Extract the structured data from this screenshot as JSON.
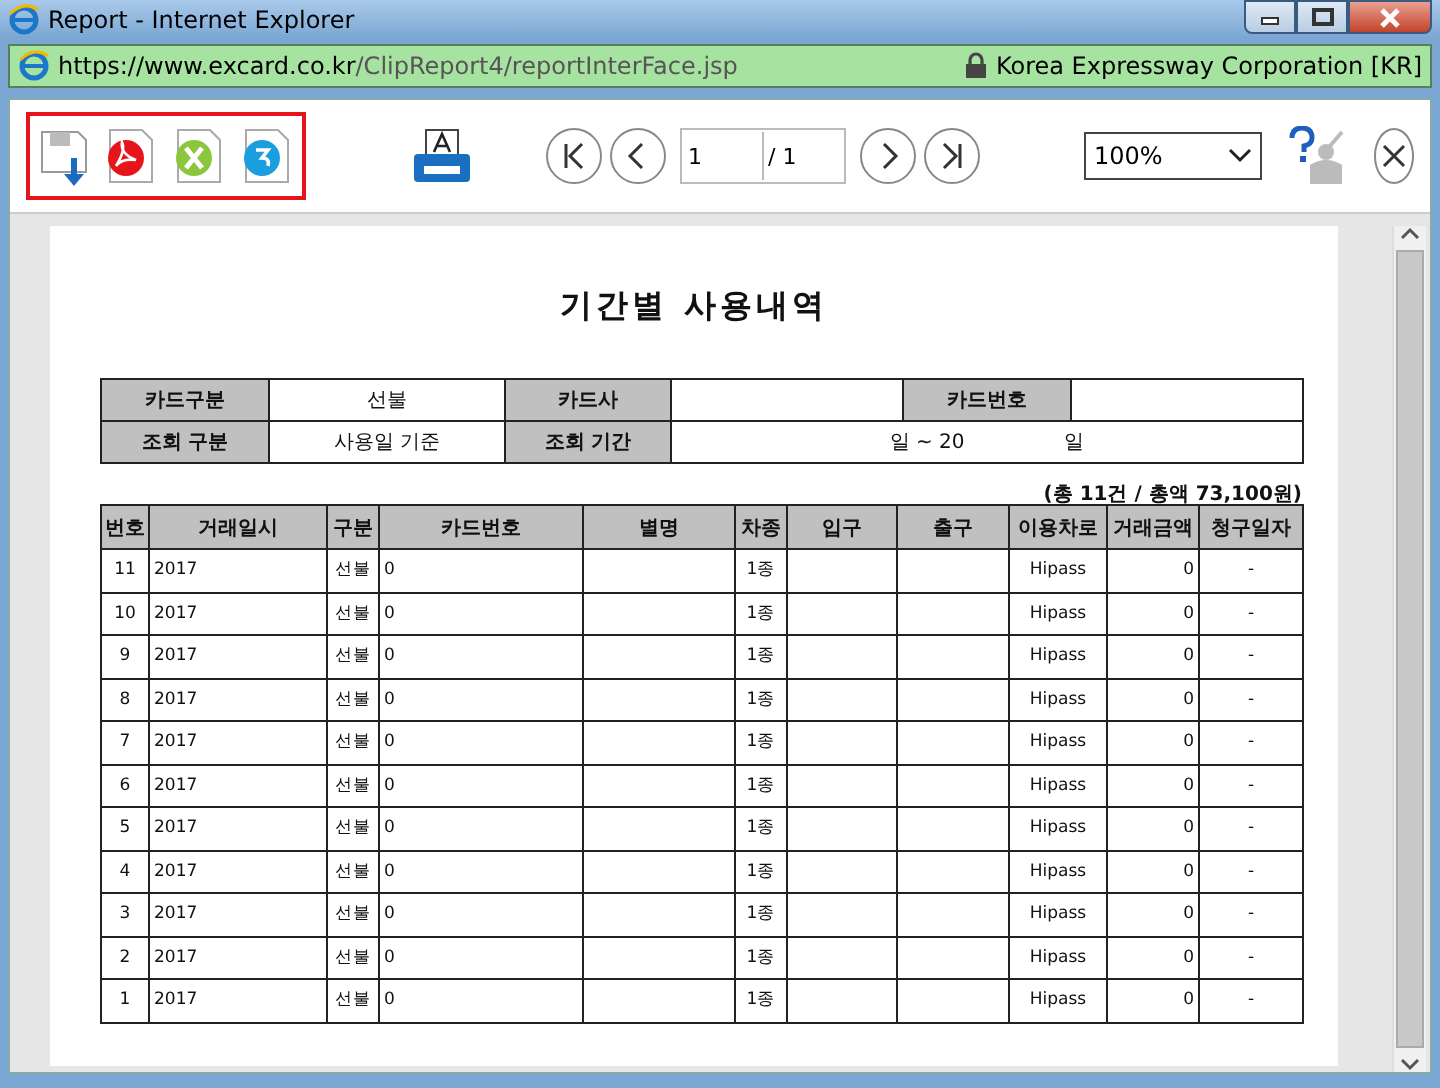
{
  "window": {
    "title": "Report - Internet Explorer"
  },
  "address_bar": {
    "scheme": "https://",
    "domain": "www.excard.co.kr",
    "path": "/ClipReport4/reportInterFace.jsp",
    "certificate": "Korea Expressway Corporation [KR]"
  },
  "toolbar": {
    "page": "1",
    "page_total": "/ 1",
    "zoom": "100%"
  },
  "report": {
    "title": "기간별 사용내역",
    "info_rows": [
      {
        "cells": [
          {
            "kind": "label",
            "text": "카드구분"
          },
          {
            "kind": "value",
            "text": "선불"
          },
          {
            "kind": "label",
            "text": "카드사"
          },
          {
            "kind": "value"
          },
          {
            "kind": "label",
            "text": "카드번호"
          },
          {
            "kind": "value"
          }
        ]
      },
      {
        "cells": [
          {
            "kind": "label",
            "text": "조회 구분"
          },
          {
            "kind": "value",
            "text": "사용일 기준"
          },
          {
            "kind": "label",
            "text": "조회 기간"
          },
          {
            "kind": "period",
            "parts": [
              "일 ~ 20",
              "일"
            ]
          }
        ]
      }
    ],
    "summary": "(총 11건 / 총액 73,100원)",
    "columns": [
      "번호",
      "거래일시",
      "구분",
      "카드번호",
      "별명",
      "차종",
      "입구",
      "출구",
      "이용차로",
      "거래금액",
      "청구일자"
    ],
    "rows": [
      {
        "no": "11",
        "datetime": "2017",
        "type": "선불",
        "card_no": "0",
        "vehicle_class": "1종",
        "lane": "Hipass",
        "amount": "0",
        "claim_date": "-"
      },
      {
        "no": "10",
        "datetime": "2017",
        "type": "선불",
        "card_no": "0",
        "vehicle_class": "1종",
        "lane": "Hipass",
        "amount": "0",
        "claim_date": "-"
      },
      {
        "no": "9",
        "datetime": "2017",
        "type": "선불",
        "card_no": "0",
        "vehicle_class": "1종",
        "lane": "Hipass",
        "amount": "0",
        "claim_date": "-"
      },
      {
        "no": "8",
        "datetime": "2017",
        "type": "선불",
        "card_no": "0",
        "vehicle_class": "1종",
        "lane": "Hipass",
        "amount": "0",
        "claim_date": "-"
      },
      {
        "no": "7",
        "datetime": "2017",
        "type": "선불",
        "card_no": "0",
        "vehicle_class": "1종",
        "lane": "Hipass",
        "amount": "0",
        "claim_date": "-"
      },
      {
        "no": "6",
        "datetime": "2017",
        "type": "선불",
        "card_no": "0",
        "vehicle_class": "1종",
        "lane": "Hipass",
        "amount": "0",
        "claim_date": "-"
      },
      {
        "no": "5",
        "datetime": "2017",
        "type": "선불",
        "card_no": "0",
        "vehicle_class": "1종",
        "lane": "Hipass",
        "amount": "0",
        "claim_date": "-"
      },
      {
        "no": "4",
        "datetime": "2017",
        "type": "선불",
        "card_no": "0",
        "vehicle_class": "1종",
        "lane": "Hipass",
        "amount": "0",
        "claim_date": "-"
      },
      {
        "no": "3",
        "datetime": "2017",
        "type": "선불",
        "card_no": "0",
        "vehicle_class": "1종",
        "lane": "Hipass",
        "amount": "0",
        "claim_date": "-"
      },
      {
        "no": "2",
        "datetime": "2017",
        "type": "선불",
        "card_no": "0",
        "vehicle_class": "1종",
        "lane": "Hipass",
        "amount": "0",
        "claim_date": "-"
      },
      {
        "no": "1",
        "datetime": "2017",
        "type": "선불",
        "card_no": "0",
        "vehicle_class": "1종",
        "lane": "Hipass",
        "amount": "0",
        "claim_date": "-"
      }
    ]
  }
}
